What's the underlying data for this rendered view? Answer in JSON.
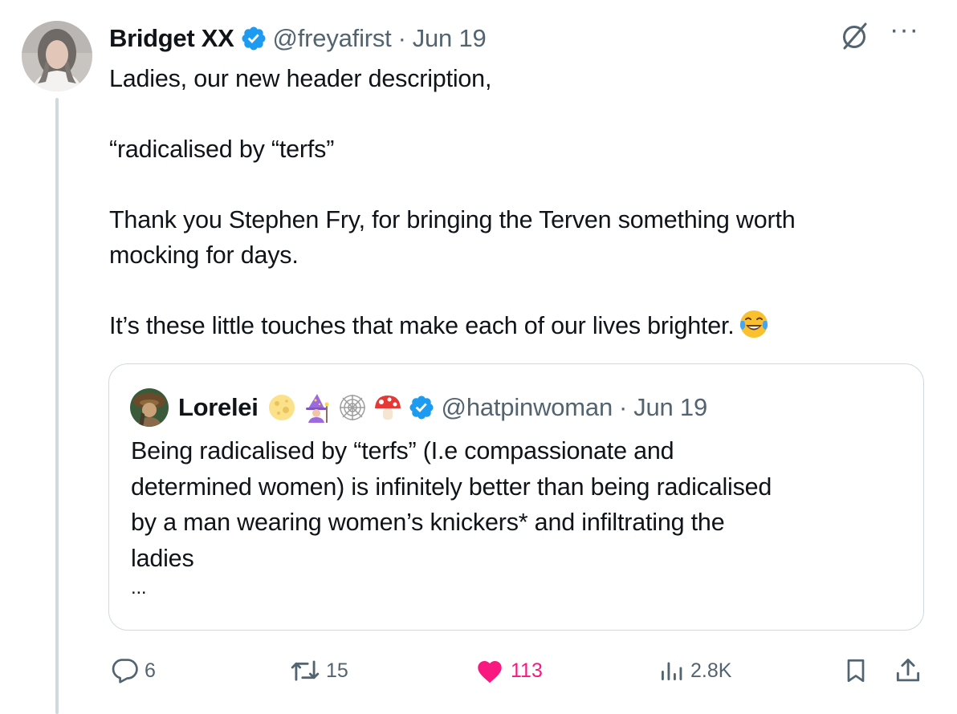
{
  "tweet": {
    "author_name": "Bridget XX",
    "handle": "@freyafirst",
    "separator": "·",
    "date": "Jun 19",
    "more_label": "···",
    "text_lines": {
      "l1": "Ladies, our new header description,",
      "l2": "“radicalised by “terfs”",
      "l3": "Thank you Stephen Fry, for  bringing the Terven  something worth",
      "l4": "mocking for days.",
      "l5": "It’s these little touches that make each of our lives brighter."
    }
  },
  "quote": {
    "author_name": "Lorelei",
    "handle": "@hatpinwoman",
    "separator": "·",
    "date": "Jun 19",
    "name_emojis": [
      "moon-emoji",
      "mage-emoji",
      "spider-web-emoji",
      "mushroom-emoji"
    ],
    "text_lines": {
      "l1": "Being radicalised by “terfs” (I.e compassionate and",
      "l2": "determined women) is infinitely better than being radicalised",
      "l3": "by a man wearing women’s knickers* and infiltrating the",
      "l4": "ladies",
      "l5": "..."
    }
  },
  "actions": {
    "replies": "6",
    "reposts": "15",
    "likes": "113",
    "views": "2.8K"
  },
  "colors": {
    "text": "#0f1419",
    "secondary": "#536471",
    "verified": "#1d9bf0",
    "like": "#f91880",
    "border": "#cfd9de"
  }
}
